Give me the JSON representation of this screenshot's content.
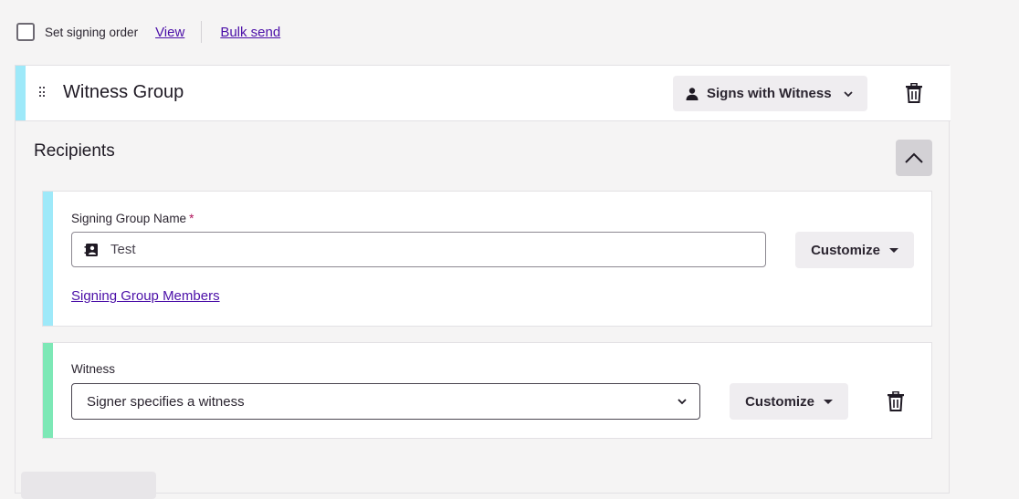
{
  "topbar": {
    "signing_order_label": "Set signing order",
    "signing_order_checked": false,
    "view_link": "View",
    "bulk_send_link": "Bulk send"
  },
  "group": {
    "title": "Witness Group",
    "role_label": "Signs with Witness",
    "accent_color": "#9ee9f9"
  },
  "recipients": {
    "title": "Recipients",
    "signing_group": {
      "field_label": "Signing Group Name",
      "required_mark": "*",
      "value": "Test",
      "customize_label": "Customize",
      "members_link": "Signing Group Members"
    },
    "witness": {
      "field_label": "Witness",
      "selected_option": "Signer specifies a witness",
      "customize_label": "Customize",
      "accent_color": "#7de8b6"
    }
  },
  "icons": {
    "drag": "drag-handle-icon",
    "person": "person-icon",
    "chevron": "chevron-down-icon",
    "trash": "trash-icon",
    "collapse": "chevron-up-icon",
    "contact": "contact-card-icon"
  }
}
